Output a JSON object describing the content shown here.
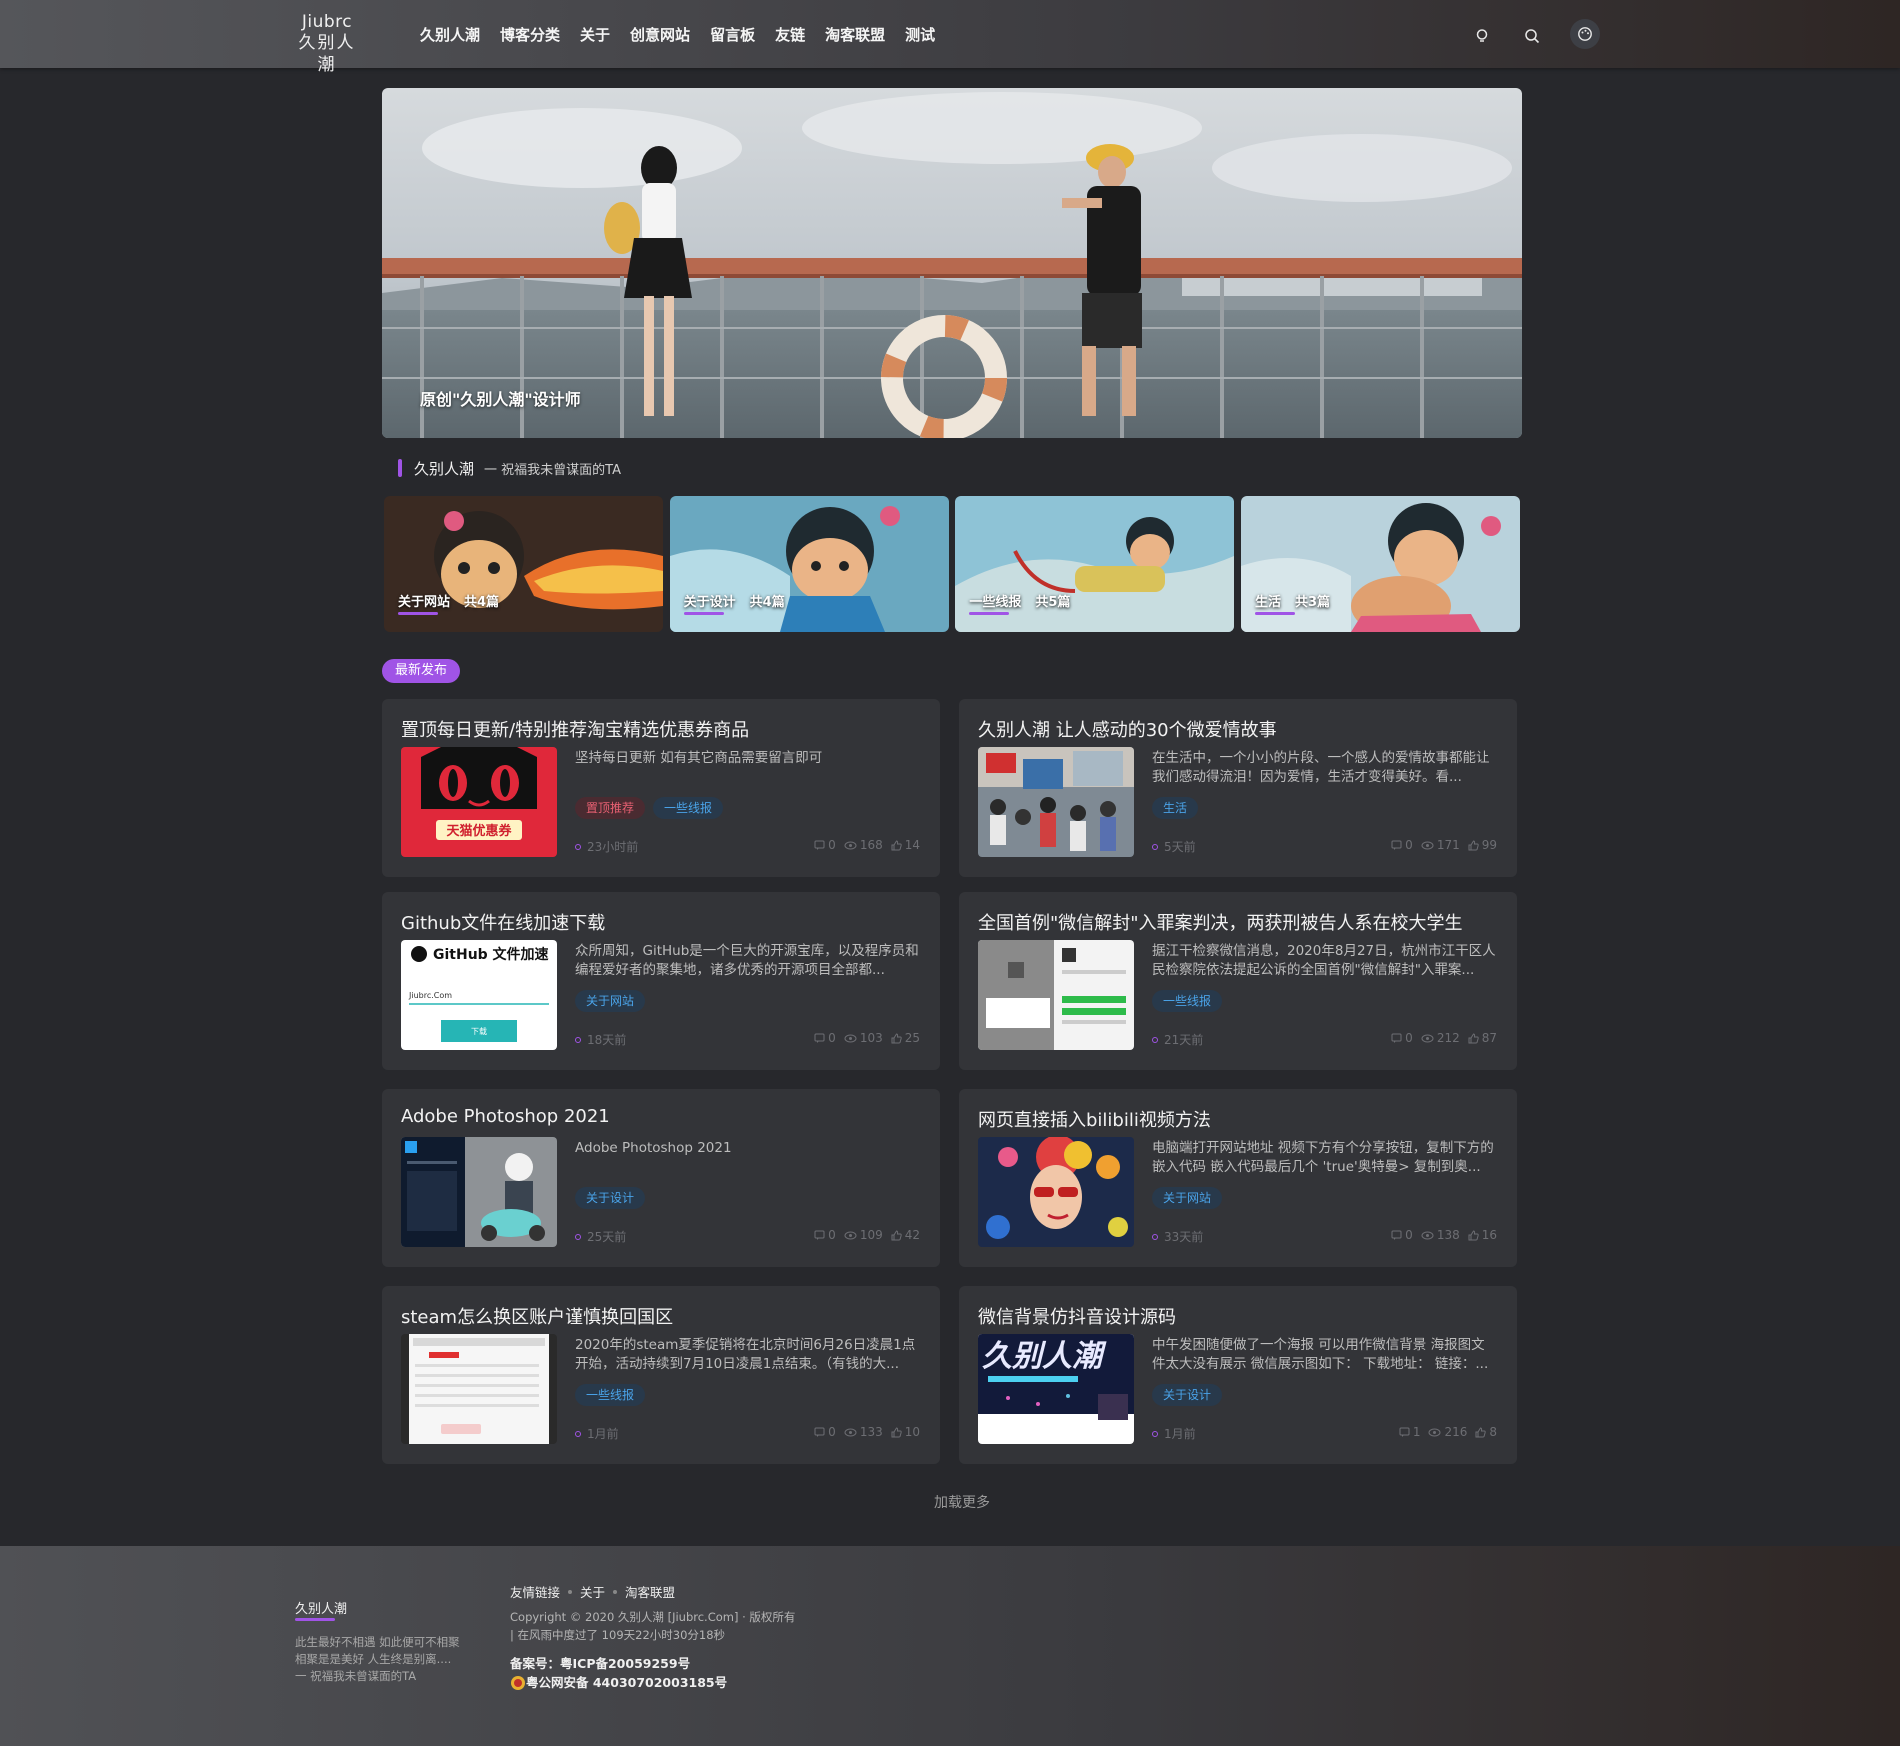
{
  "header": {
    "logo_en": "Jiubrc",
    "logo_cn": "久别人潮",
    "nav": [
      "久别人潮",
      "博客分类",
      "关于",
      "创意网站",
      "留言板",
      "友链",
      "淘客联盟",
      "测试"
    ]
  },
  "banner": {
    "caption": "原创\"久别人潮\"设计师"
  },
  "section": {
    "title": "久别人潮",
    "subtitle": "一 祝福我未曾谋面的TA"
  },
  "categories": [
    {
      "name": "关于网站",
      "count": "共4篇"
    },
    {
      "name": "关于设计",
      "count": "共4篇"
    },
    {
      "name": "一些线报",
      "count": "共5篇"
    },
    {
      "name": "生活",
      "count": "共3篇"
    }
  ],
  "latest_label": "最新发布",
  "posts": [
    {
      "title": "置顶每日更新/特别推荐淘宝精选优惠券商品",
      "excerpt": "坚持每日更新 如有其它商品需要留言即可",
      "tags": [
        {
          "text": "置顶推荐",
          "style": "red"
        },
        {
          "text": "一些线报",
          "style": "blue"
        }
      ],
      "time": "23小时前",
      "comments": "0",
      "views": "168",
      "likes": "14"
    },
    {
      "title": "久别人潮 让人感动的30个微爱情故事",
      "excerpt": "在生活中，一个小小的片段、一个感人的爱情故事都能让我们感动得流泪！因为爱情，生活才变得美好。看...",
      "tags": [
        {
          "text": "生活",
          "style": "blue"
        }
      ],
      "time": "5天前",
      "comments": "0",
      "views": "171",
      "likes": "99"
    },
    {
      "title": "Github文件在线加速下载",
      "excerpt": "众所周知，GitHub是一个巨大的开源宝库，以及程序员和编程爱好者的聚集地，诸多优秀的开源项目全部都...",
      "tags": [
        {
          "text": "关于网站",
          "style": "blue"
        }
      ],
      "time": "18天前",
      "comments": "0",
      "views": "103",
      "likes": "25"
    },
    {
      "title": "全国首例\"微信解封\"入罪案判决，两获刑被告人系在校大学生",
      "excerpt": "据江干检察微信消息，2020年8月27日，杭州市江干区人民检察院依法提起公诉的全国首例\"微信解封\"入罪案...",
      "tags": [
        {
          "text": "一些线报",
          "style": "blue"
        }
      ],
      "time": "21天前",
      "comments": "0",
      "views": "212",
      "likes": "87"
    },
    {
      "title": "Adobe Photoshop 2021",
      "excerpt": "Adobe Photoshop 2021",
      "tags": [
        {
          "text": "关于设计",
          "style": "blue"
        }
      ],
      "time": "25天前",
      "comments": "0",
      "views": "109",
      "likes": "42"
    },
    {
      "title": "网页直接插入bilibili视频方法",
      "excerpt": "电脑端打开网站地址 视频下方有个分享按钮，复制下方的嵌入代码 嵌入代码最后几个 'true'奥特曼> 复制到奥...",
      "tags": [
        {
          "text": "关于网站",
          "style": "blue"
        }
      ],
      "time": "33天前",
      "comments": "0",
      "views": "138",
      "likes": "16"
    },
    {
      "title": "steam怎么换区账户谨慎换回国区",
      "excerpt": "2020年的steam夏季促销将在北京时间6月26日凌晨1点开始，活动持续到7月10日凌晨1点结束。（有钱的大...",
      "tags": [
        {
          "text": "一些线报",
          "style": "blue"
        }
      ],
      "time": "1月前",
      "comments": "0",
      "views": "133",
      "likes": "10"
    },
    {
      "title": "微信背景仿抖音设计源码",
      "excerpt": "中午发困随便做了一个海报 可以用作微信背景 海报图文件太大没有展示 微信展示图如下： 下载地址： 链接：...",
      "tags": [
        {
          "text": "关于设计",
          "style": "blue"
        }
      ],
      "time": "1月前",
      "comments": "1",
      "views": "216",
      "likes": "8"
    }
  ],
  "thumb_text": {
    "tmall": "天猫优惠券",
    "github_title": "GitHub 文件加速",
    "github_input": "Jiubrc.Com",
    "github_btn": "下载",
    "poster": "久别人潮"
  },
  "load_more": "加载更多",
  "footer": {
    "name": "久别人潮",
    "desc": [
      "此生最好不相遇 如此便可不相聚",
      "相聚是是美好 人生终是别离....",
      "一 祝福我未曾谋面的TA"
    ],
    "links": [
      "友情链接",
      "关于",
      "淘客联盟"
    ],
    "copyright": "Copyright © 2020 久别人潮 [Jiubrc.Com] · 版权所有",
    "runtime": "| 在风雨中度过了 109天22小时30分18秒",
    "icp": "备案号：粤ICP备20059259号",
    "police": "粤公网安备 44030702003185号"
  },
  "colors": {
    "accent": "#a054e6",
    "card_bg": "#333438",
    "page_bg": "#27282c",
    "tag_blue": "#4aa3e8",
    "tag_red": "#e86072"
  }
}
